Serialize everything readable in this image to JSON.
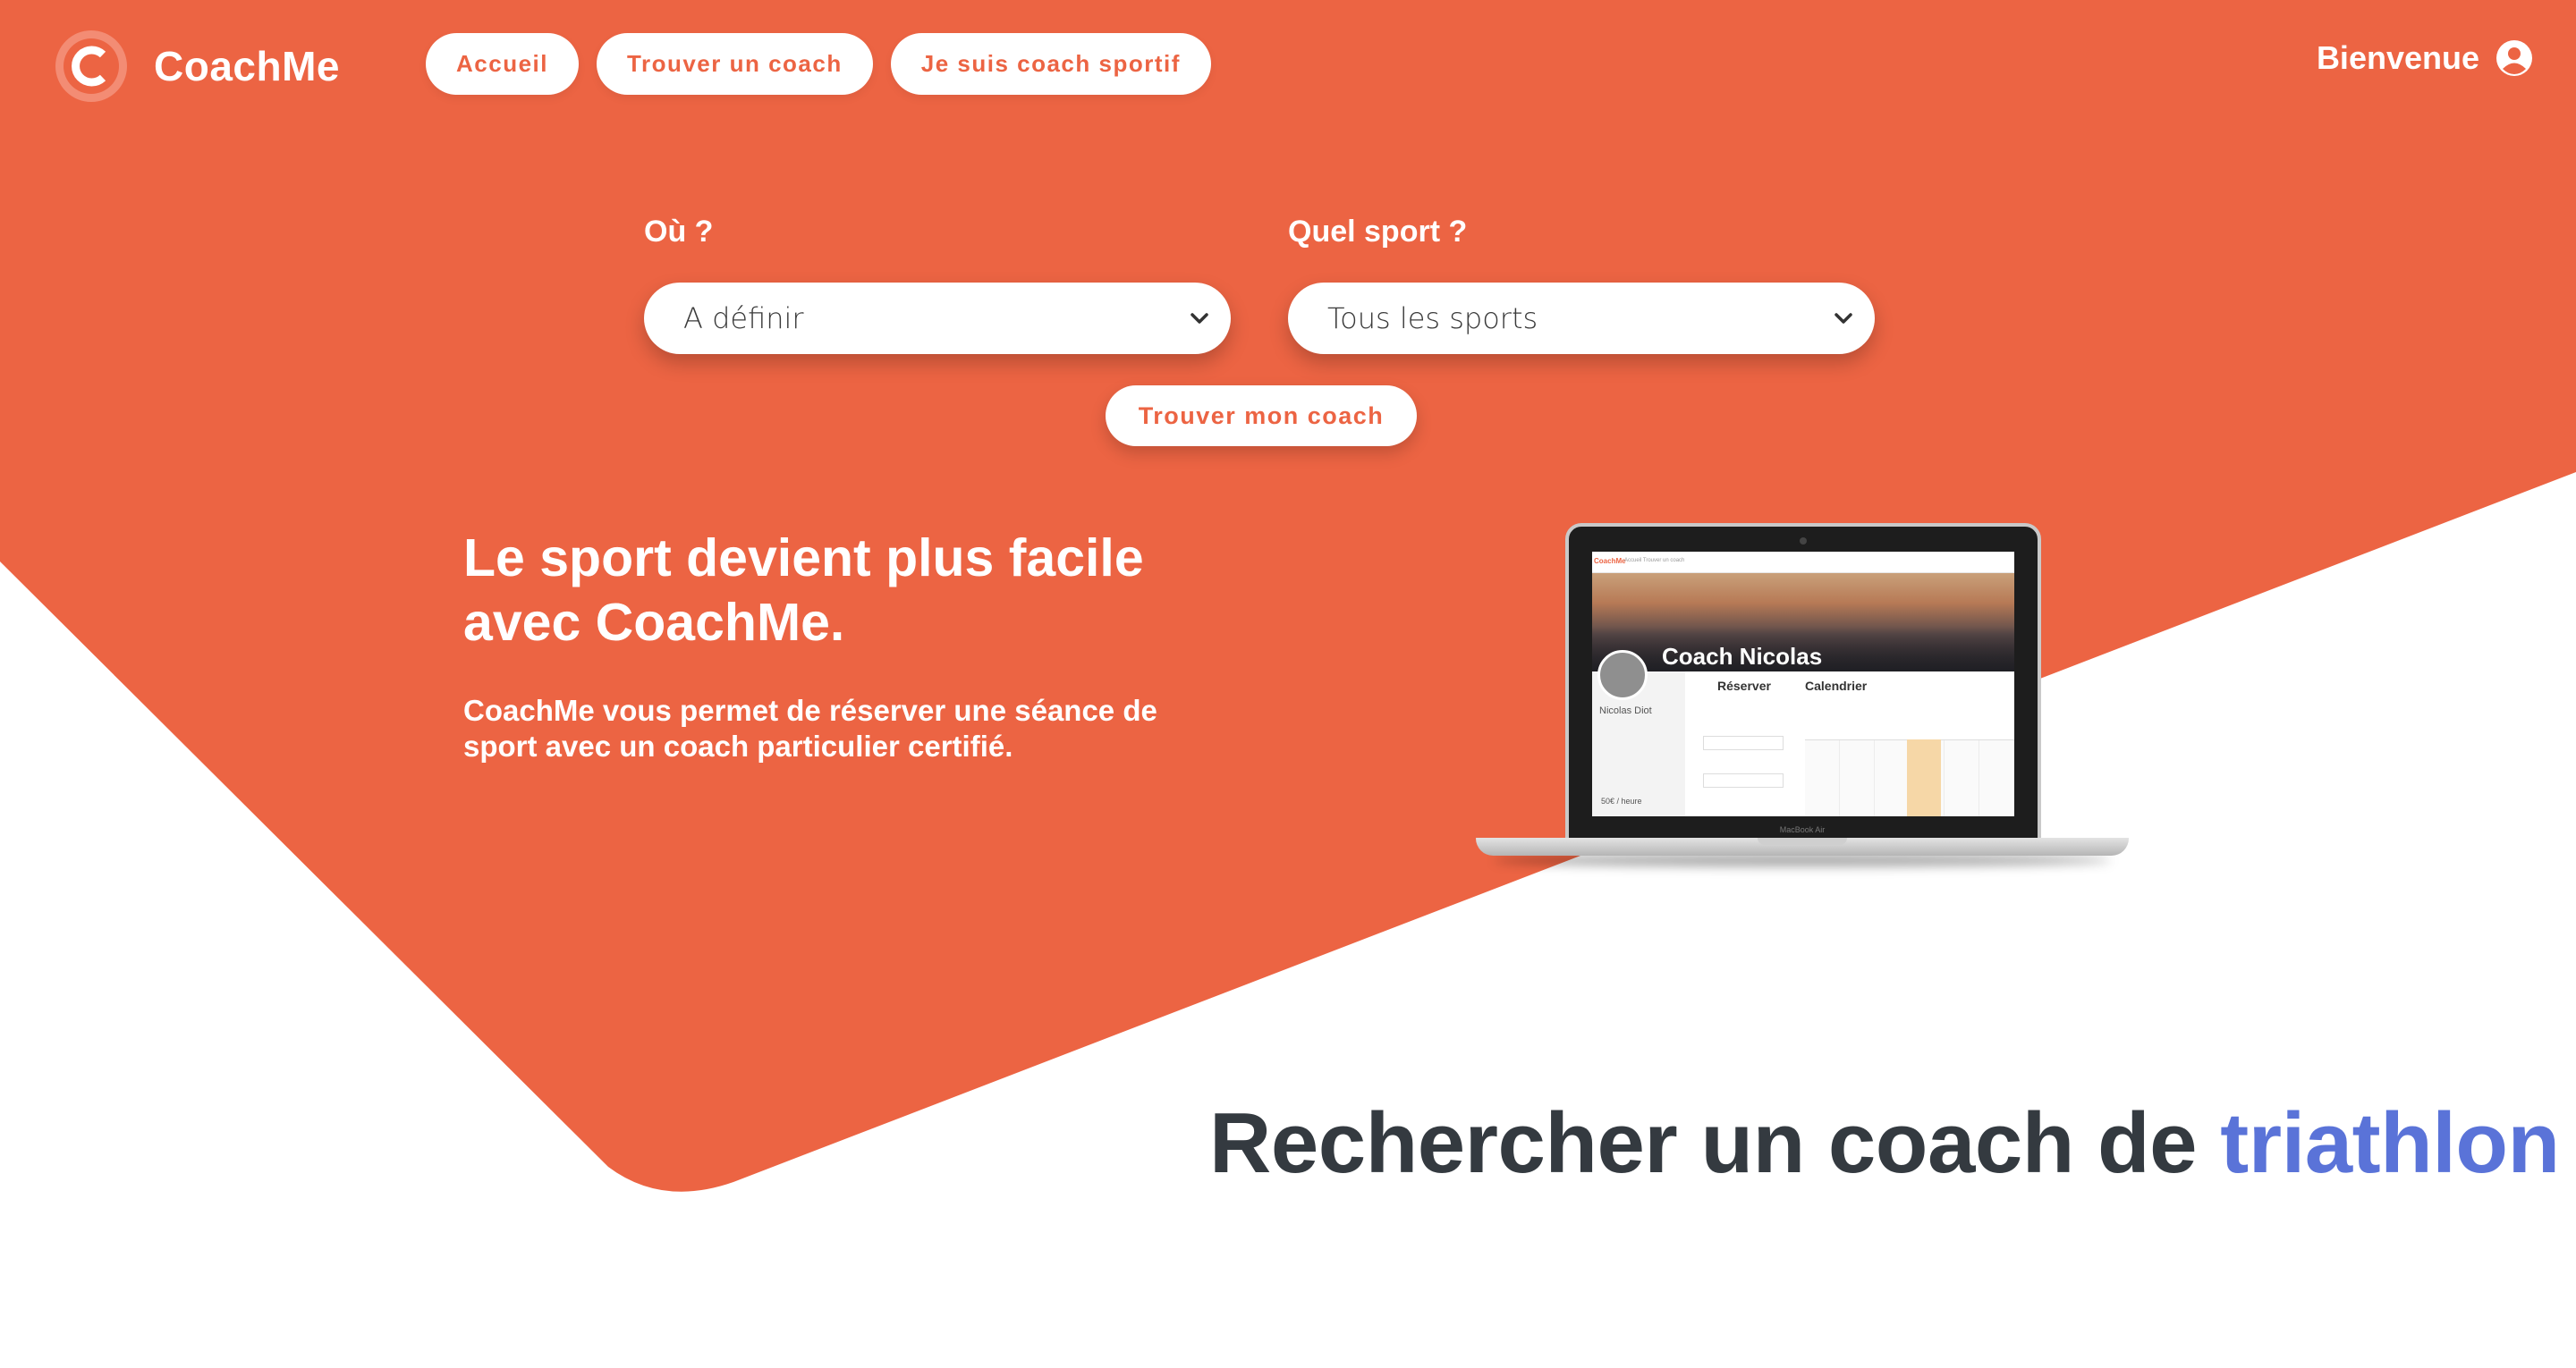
{
  "brand": {
    "name": "CoachMe",
    "letter": "C"
  },
  "nav": {
    "home": "Accueil",
    "find_coach": "Trouver un coach",
    "i_am_coach": "Je suis coach sportif"
  },
  "account": {
    "welcome": "Bienvenue",
    "icon": "user-circle-icon"
  },
  "search": {
    "where_label": "Où ?",
    "where_value": "A définir",
    "sport_label": "Quel sport ?",
    "sport_value": "Tous les sports",
    "submit": "Trouver mon coach"
  },
  "hero": {
    "title": "Le sport devient plus facile avec CoachMe.",
    "description": "CoachMe vous permet de réserver une séance de sport avec un coach particulier certifié."
  },
  "preview": {
    "coach_title": "Coach Nicolas",
    "coach_name": "Nicolas Diot",
    "reserve": "Réserver",
    "calendar": "Calendrier",
    "price": "50€ / heure",
    "device": "MacBook Air",
    "nav_links": "Accueil    Trouver un coach"
  },
  "section": {
    "title_prefix": "Rechercher un coach de",
    "sport": "triathlon"
  },
  "colors": {
    "primary": "#ec6443",
    "accent": "#5a73d8",
    "heading": "#343a40"
  }
}
